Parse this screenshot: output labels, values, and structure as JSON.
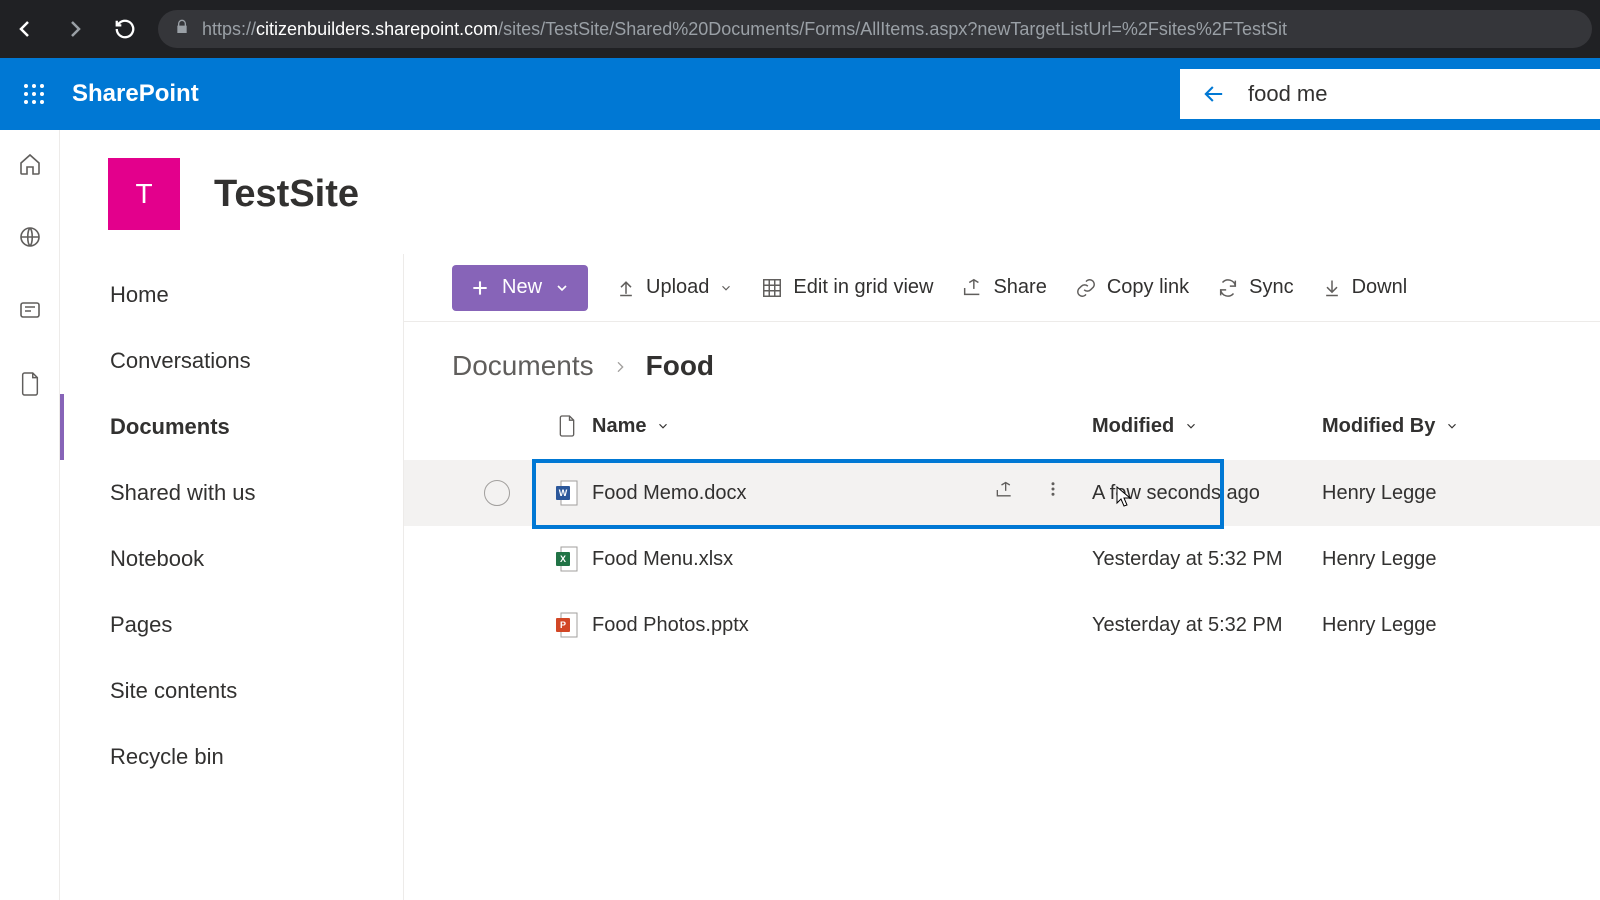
{
  "browser": {
    "url_host": "citizenbuilders.sharepoint.com",
    "url_path": "/sites/TestSite/Shared%20Documents/Forms/AllItems.aspx?newTargetListUrl=%2Fsites%2FTestSit"
  },
  "suite": {
    "product": "SharePoint",
    "search_value": "food me"
  },
  "site": {
    "logo_letter": "T",
    "title": "TestSite"
  },
  "nav": {
    "items": [
      "Home",
      "Conversations",
      "Documents",
      "Shared with us",
      "Notebook",
      "Pages",
      "Site contents",
      "Recycle bin"
    ],
    "selected_index": 2
  },
  "commands": {
    "new": "New",
    "upload": "Upload",
    "edit_grid": "Edit in grid view",
    "share": "Share",
    "copy_link": "Copy link",
    "sync": "Sync",
    "download": "Downl"
  },
  "breadcrumb": {
    "root": "Documents",
    "leaf": "Food"
  },
  "table": {
    "headers": {
      "name": "Name",
      "modified": "Modified",
      "modified_by": "Modified By"
    },
    "rows": [
      {
        "icon": "word",
        "name": "Food Memo.docx",
        "modified": "A few seconds ago",
        "by": "Henry Legge",
        "highlight": true,
        "hover": true
      },
      {
        "icon": "excel",
        "name": "Food Menu.xlsx",
        "modified": "Yesterday at 5:32 PM",
        "by": "Henry Legge"
      },
      {
        "icon": "ppt",
        "name": "Food Photos.pptx",
        "modified": "Yesterday at 5:32 PM",
        "by": "Henry Legge"
      }
    ]
  }
}
